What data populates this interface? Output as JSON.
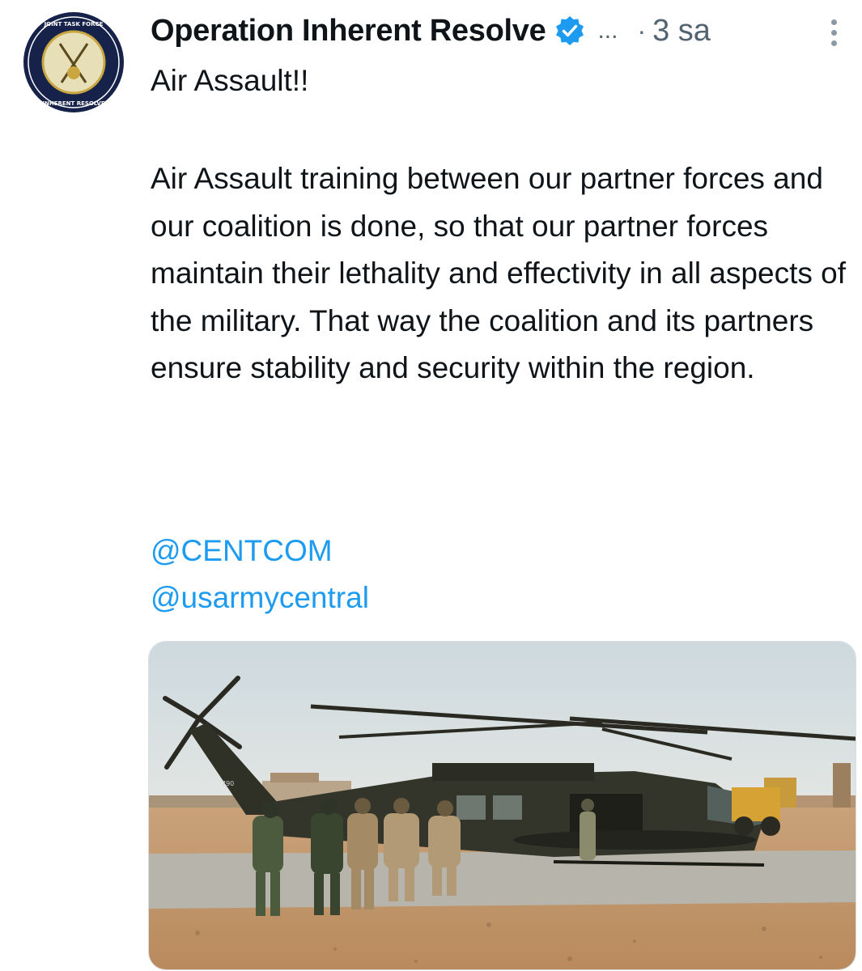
{
  "account": {
    "name": "Operation Inherent Resolve",
    "avatar_alt": "Operation Inherent Resolve seal",
    "verified_icon": "verified-badge-icon"
  },
  "tweet": {
    "truncation": "...",
    "separator": "·",
    "time": "3 sa",
    "title": "Air Assault!!",
    "body": "Air Assault training between our partner forces and our coalition is done, so that our partner forces maintain their lethality and effectivity in all aspects of the military. That way the coalition and its partners ensure stability and security within the region.",
    "mentions": [
      "@CENTCOM",
      "@usarmycentral"
    ]
  },
  "media": {
    "description": "Soldiers walking toward a military helicopter on a desert landing pad",
    "tail_number": "790"
  },
  "colors": {
    "accent": "#1d9bf0",
    "secondary_text": "#536471"
  }
}
